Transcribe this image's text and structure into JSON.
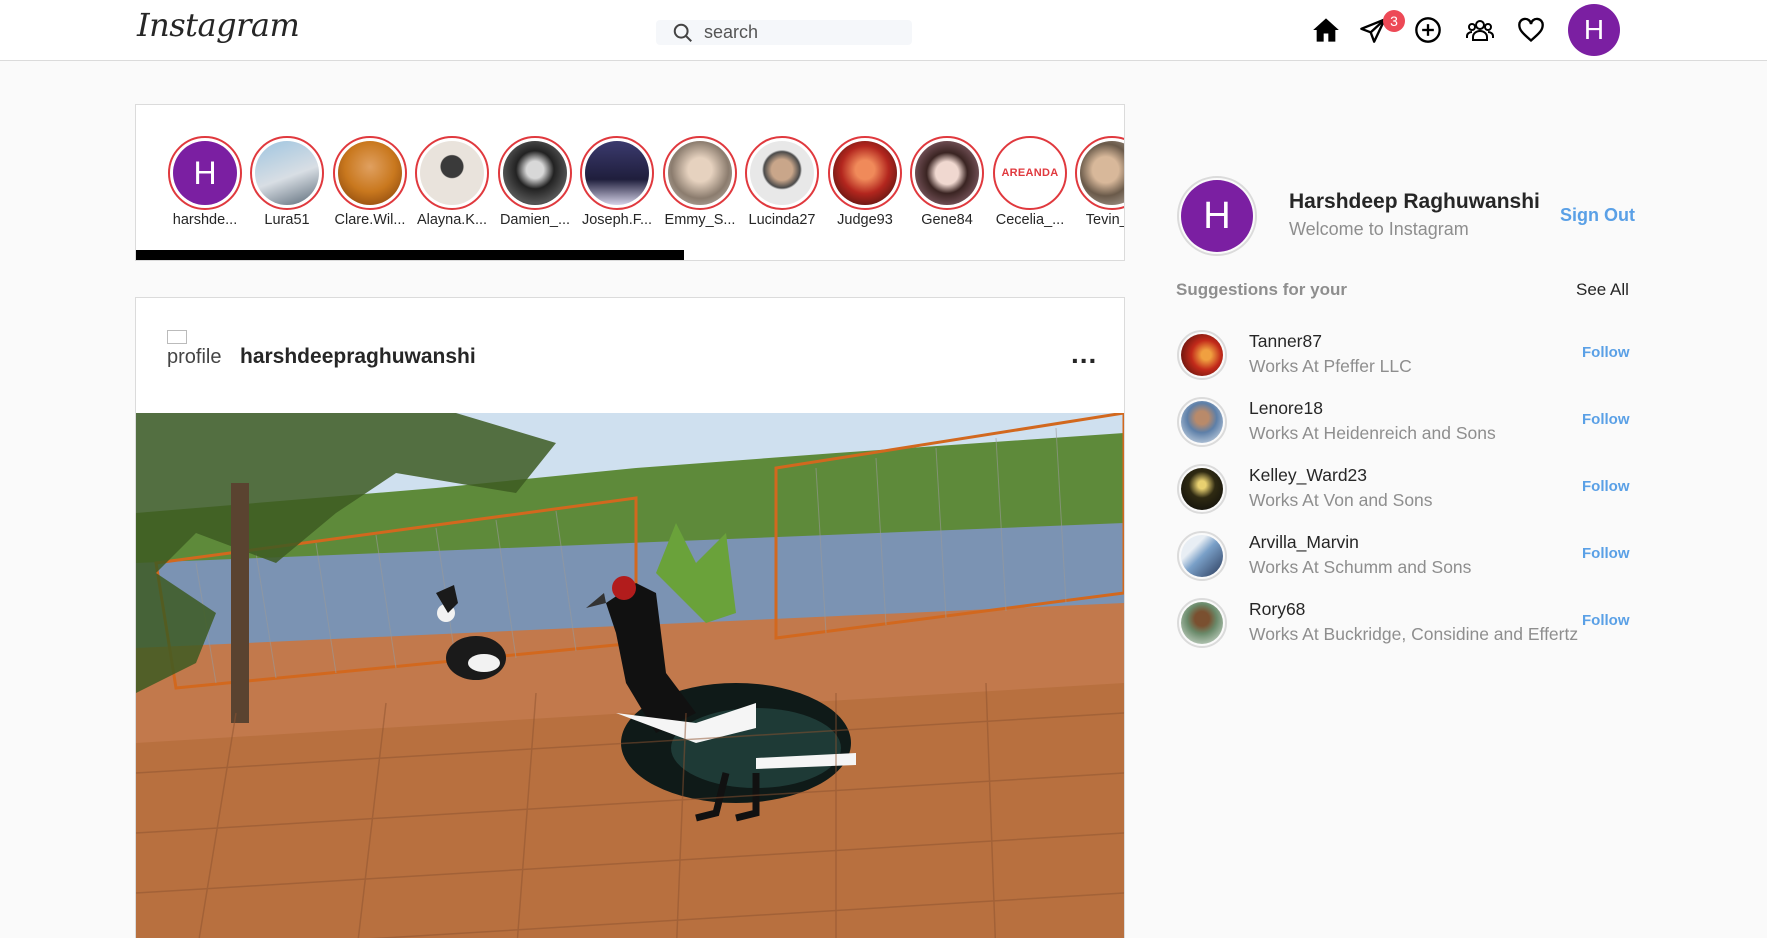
{
  "header": {
    "logo": "Instagram",
    "search_placeholder": "search",
    "messages_badge": "3",
    "avatar_letter": "H"
  },
  "stories": [
    {
      "name": "harshde...",
      "letter": "H",
      "color": "#7b1fa2"
    },
    {
      "name": "Lura51",
      "letter": "",
      "color": "#8aa7c4"
    },
    {
      "name": "Clare.Wil...",
      "letter": "",
      "color": "#c9781e"
    },
    {
      "name": "Alayna.K...",
      "letter": "",
      "color": "#d8d0c8"
    },
    {
      "name": "Damien_...",
      "letter": "",
      "color": "#3a3a3a"
    },
    {
      "name": "Joseph.F...",
      "letter": "",
      "color": "#1f1e3c"
    },
    {
      "name": "Emmy_S...",
      "letter": "",
      "color": "#b9ab9d"
    },
    {
      "name": "Lucinda27",
      "letter": "",
      "color": "#cfcfcf"
    },
    {
      "name": "Judge93",
      "letter": "",
      "color": "#b3261e"
    },
    {
      "name": "Gene84",
      "letter": "",
      "color": "#a77a88"
    },
    {
      "name": "Cecelia_...",
      "letter": "",
      "color": "#ffffff",
      "logo_text": "AREANDA"
    },
    {
      "name": "Tevin_D",
      "letter": "",
      "color": "#9a8a7a"
    }
  ],
  "post": {
    "profile_alt": "profile",
    "username": "harshdeepraghuwanshi",
    "more": "..."
  },
  "sidebar": {
    "name": "Harshdeep Raghuwanshi",
    "subtitle": "Welcome to Instagram",
    "avatar_letter": "H",
    "sign_out": "Sign Out",
    "suggestions_title": "Suggestions for your",
    "see_all": "See All",
    "follow_label": "Follow",
    "suggestions": [
      {
        "username": "Tanner87",
        "work": "Works At Pfeffer LLC",
        "color": "#c22a1a"
      },
      {
        "username": "Lenore18",
        "work": "Works At Heidenreich and Sons",
        "color": "#5d7fa8"
      },
      {
        "username": "Kelley_Ward23",
        "work": "Works At Von and Sons",
        "color": "#2f2a12"
      },
      {
        "username": "Arvilla_Marvin",
        "work": "Works At Schumm and Sons",
        "color": "#7aa0c8"
      },
      {
        "username": "Rory68",
        "work": "Works At Buckridge, Considine and Effertz",
        "color": "#6a8a6a"
      }
    ]
  }
}
